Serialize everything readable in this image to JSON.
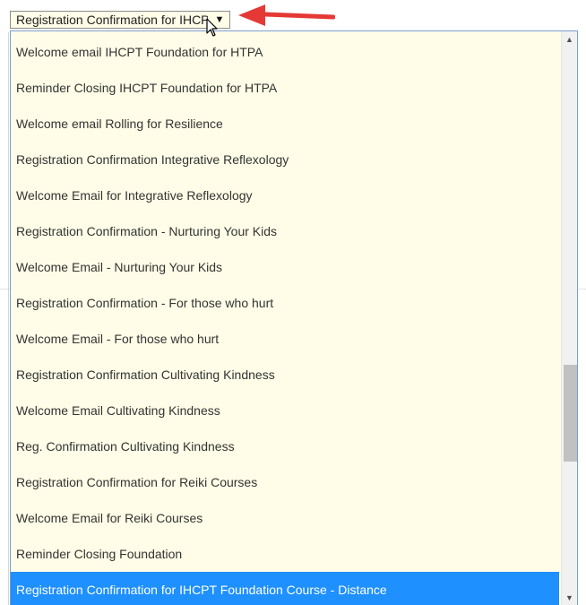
{
  "select": {
    "value": "Registration Confirmation for IHCPT Foundation Course - Distance",
    "arrow_icon": "triangle-down"
  },
  "dropdown": {
    "options": [
      "Welcome email IHCPT Foundation for HTPA",
      "Reminder Closing IHCPT Foundation for HTPA",
      "Welcome email Rolling for Resilience",
      "Registration Confirmation Integrative Reflexology",
      "Welcome Email for Integrative Reflexology",
      "Registration Confirmation - Nurturing Your Kids",
      "Welcome Email - Nurturing Your Kids",
      "Registration Confirmation - For those who hurt",
      "Welcome Email - For those who hurt",
      "Registration Confirmation Cultivating Kindness",
      "Welcome Email Cultivating Kindness",
      "Reg. Confirmation Cultivating Kindness",
      "Registration Confirmation for Reiki Courses",
      "Welcome Email for Reiki Courses",
      "Reminder Closing Foundation",
      "Registration Confirmation for IHCPT Foundation Course - Distance"
    ],
    "selected_index": 15,
    "scroll_position": 0.7
  },
  "colors": {
    "option_background": "#fffde7",
    "selected_background": "#1e90ff",
    "annotation_arrow": "#e53935"
  },
  "icons": {
    "cursor": "pointer-arrow-icon",
    "annotation": "red-arrow-icon",
    "scroll_up": "scroll-up-icon",
    "scroll_down": "scroll-down-icon"
  }
}
